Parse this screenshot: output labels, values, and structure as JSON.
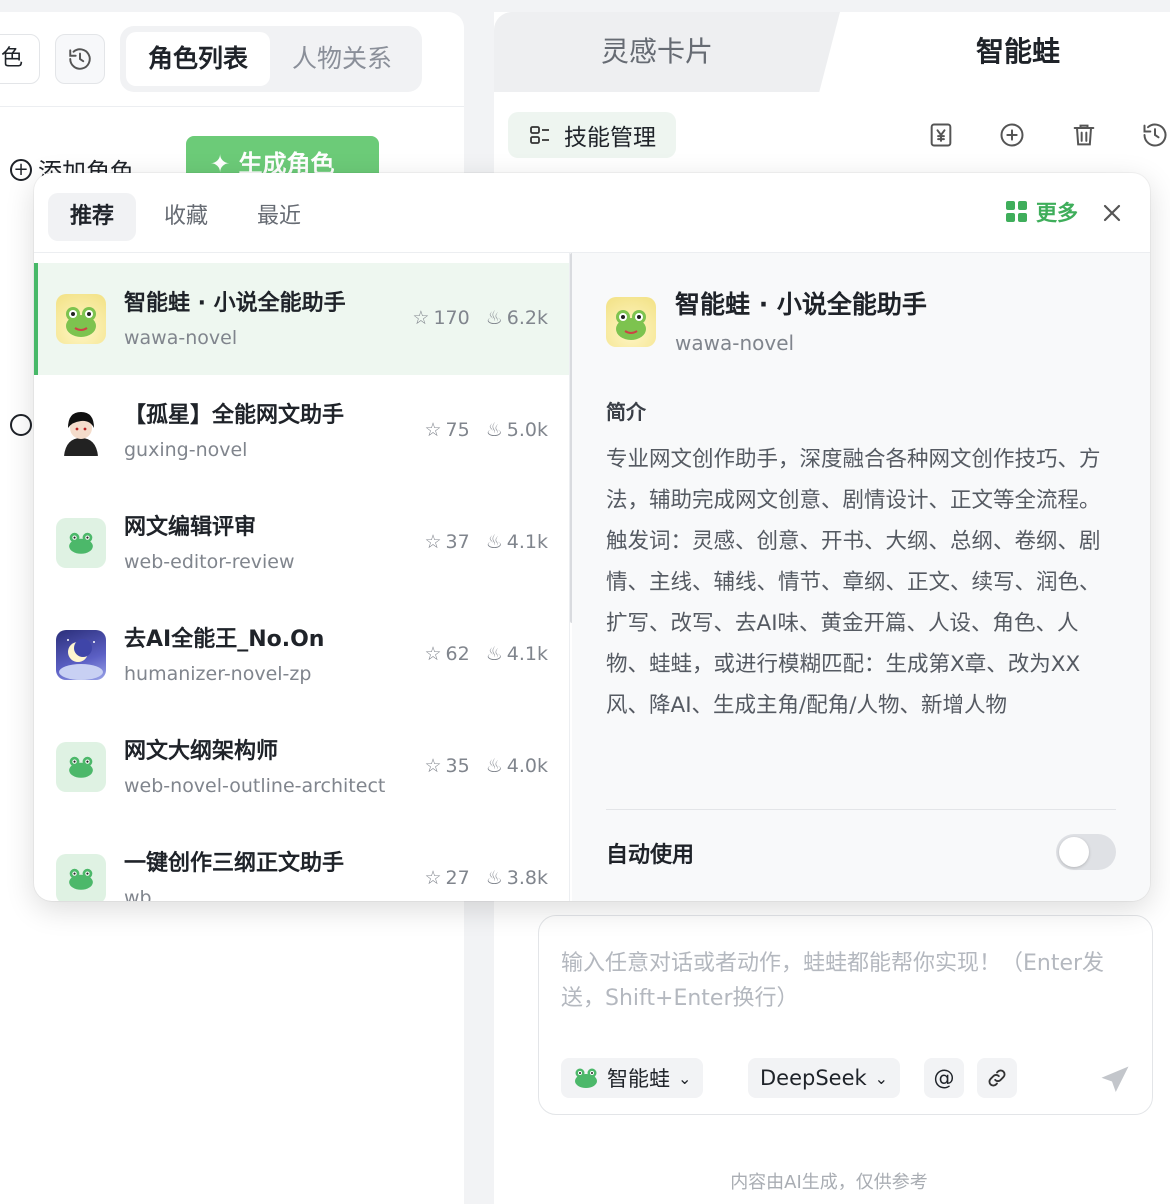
{
  "left_panel": {
    "cut_button_label": "色",
    "segments": [
      "角色列表",
      "人物关系"
    ],
    "add_role_label": "添加角色",
    "generate_role_label": "生成角色"
  },
  "right_panel": {
    "tabs": [
      "灵感卡片",
      "智能蛙"
    ],
    "skill_manage_label": "技能管理",
    "toolbar_icons": [
      "yen-icon",
      "add-circle-icon",
      "trash-icon",
      "history-icon"
    ]
  },
  "popup": {
    "tabs": [
      "推荐",
      "收藏",
      "最近"
    ],
    "more_label": "更多",
    "skills": [
      {
        "name": "智能蛙 · 小说全能助手",
        "id": "wawa-novel",
        "stars": "170",
        "heat": "6.2k",
        "avatar": "frog-3d"
      },
      {
        "name": "【孤星】全能网文助手",
        "id": "guxing-novel",
        "stars": "75",
        "heat": "5.0k",
        "avatar": "anime-boy"
      },
      {
        "name": "网文编辑评审",
        "id": "web-editor-review",
        "stars": "37",
        "heat": "4.1k",
        "avatar": "frog"
      },
      {
        "name": "去AI全能王_No.On",
        "id": "humanizer-novel-zp",
        "stars": "62",
        "heat": "4.1k",
        "avatar": "moon"
      },
      {
        "name": "网文大纲架构师",
        "id": "web-novel-outline-architect",
        "stars": "35",
        "heat": "4.0k",
        "avatar": "frog"
      },
      {
        "name": "一键创作三纲正文助手",
        "id": "wb",
        "stars": "27",
        "heat": "3.8k",
        "avatar": "frog"
      }
    ],
    "detail": {
      "name": "智能蛙 · 小说全能助手",
      "id": "wawa-novel",
      "section_title": "简介",
      "description": "专业网文创作助手，深度融合各种网文创作技巧、方法，辅助完成网文创意、剧情设计、正文等全流程。触发词：灵感、创意、开书、大纲、总纲、卷纲、剧情、主线、辅线、情节、章纲、正文、续写、润色、扩写、改写、去AI味、黄金开篇、人设、角色、人物、蛙蛙，或进行模糊匹配：生成第X章、改为XX风、降AI、生成主角/配角/人物、新增人物",
      "auto_use_label": "自动使用",
      "auto_use_enabled": false
    }
  },
  "chat": {
    "placeholder": "输入任意对话或者动作，蛙蛙都能帮你实现！（Enter发送，Shift+Enter换行）",
    "agent_label": "智能蛙",
    "model_label": "DeepSeek",
    "at_symbol": "@"
  },
  "footer": {
    "disclaimer": "内容由AI生成，仅供参考"
  },
  "colors": {
    "accent_green": "#47b868",
    "selected_row_bg": "#eef7f0",
    "generate_button": "#6ccb78"
  }
}
